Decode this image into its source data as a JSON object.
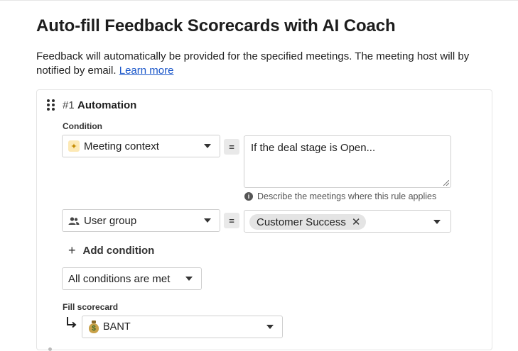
{
  "page": {
    "title": "Auto-fill Feedback Scorecards with AI Coach",
    "description": "Feedback will automatically be provided for the specified meetings. The meeting host will by notified by email.",
    "learn_more": "Learn more"
  },
  "automation": {
    "number": "#1",
    "title": "Automation",
    "condition_label": "Condition",
    "conditions": [
      {
        "field_icon": "sparkle-icon",
        "field": "Meeting context",
        "operator": "=",
        "value_text": "If the deal stage is Open...",
        "hint": "Describe the meetings where this rule applies"
      },
      {
        "field_icon": "user-group-icon",
        "field": "User group",
        "operator": "=",
        "chip": "Customer Success"
      }
    ],
    "add_condition": "Add condition",
    "match_mode": "All conditions are met",
    "fill_scorecard_label": "Fill scorecard",
    "scorecard_icon": "money-bag-icon",
    "scorecard": "BANT"
  },
  "colors": {
    "link": "#1a56c9",
    "border": "#cfcfcf",
    "chip_bg": "#e4e4e4"
  }
}
